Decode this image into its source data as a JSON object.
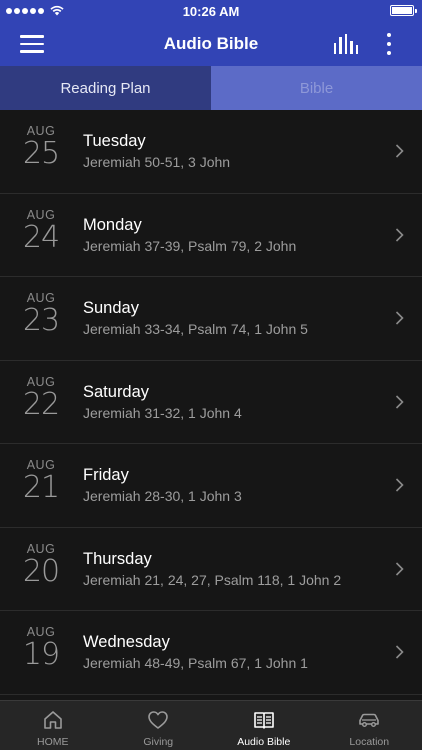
{
  "status_bar": {
    "time": "10:26 AM"
  },
  "header": {
    "title": "Audio Bible"
  },
  "tabs": [
    {
      "label": "Reading Plan",
      "active": true
    },
    {
      "label": "Bible",
      "active": false
    }
  ],
  "readings": [
    {
      "month": "AUG",
      "day": "25",
      "weekday": "Tuesday",
      "passages": "Jeremiah 50-51, 3 John"
    },
    {
      "month": "AUG",
      "day": "24",
      "weekday": "Monday",
      "passages": "Jeremiah 37-39, Psalm 79, 2 John"
    },
    {
      "month": "AUG",
      "day": "23",
      "weekday": "Sunday",
      "passages": "Jeremiah 33-34, Psalm 74, 1 John 5"
    },
    {
      "month": "AUG",
      "day": "22",
      "weekday": "Saturday",
      "passages": "Jeremiah 31-32, 1 John 4"
    },
    {
      "month": "AUG",
      "day": "21",
      "weekday": "Friday",
      "passages": "Jeremiah 28-30, 1 John 3"
    },
    {
      "month": "AUG",
      "day": "20",
      "weekday": "Thursday",
      "passages": "Jeremiah 21, 24, 27, Psalm 118, 1 John 2"
    },
    {
      "month": "AUG",
      "day": "19",
      "weekday": "Wednesday",
      "passages": "Jeremiah 48-49, Psalm 67, 1 John 1"
    }
  ],
  "bottom_nav": [
    {
      "label": "HOME",
      "icon": "home-icon",
      "active": false
    },
    {
      "label": "Giving",
      "icon": "heart-icon",
      "active": false
    },
    {
      "label": "Audio Bible",
      "icon": "book-icon",
      "active": true
    },
    {
      "label": "Location",
      "icon": "car-icon",
      "active": false
    }
  ],
  "colors": {
    "accent": "#3244b5",
    "tab_active": "#303b80",
    "tab_inactive": "#5c6bc7",
    "background": "#161616"
  }
}
